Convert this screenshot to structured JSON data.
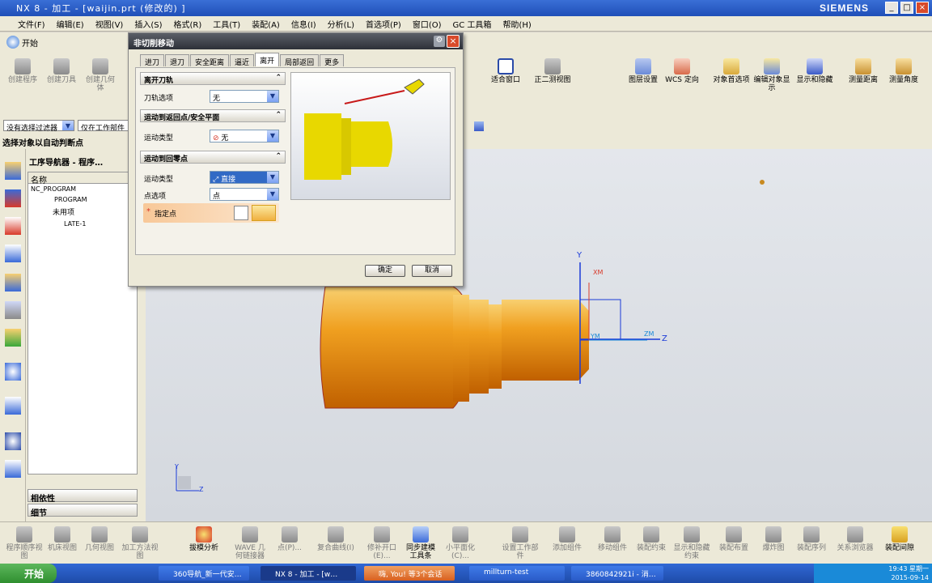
{
  "window": {
    "title": "NX 8 - 加工 - [waijin.prt  (修改的) ]",
    "brand": "SIEMENS"
  },
  "menu": [
    "文件(F)",
    "编辑(E)",
    "视图(V)",
    "插入(S)",
    "格式(R)",
    "工具(T)",
    "装配(A)",
    "信息(I)",
    "分析(L)",
    "首选项(P)",
    "窗口(O)",
    "GC 工具箱",
    "帮助(H)"
  ],
  "toolbar_top": {
    "start": "开始",
    "items": [
      "创建程序",
      "创建刀具",
      "创建几何体"
    ],
    "right_items": [
      "适合窗口",
      "正二测视图",
      "图层设置",
      "WCS 定向",
      "对象首选项",
      "编辑对象显示",
      "显示和隐藏",
      "测量距离",
      "测量角度"
    ]
  },
  "filters": {
    "selection_filter": "没有选择过滤器",
    "scope": "仅在工作部件"
  },
  "cue": "选择对象以自动判断点",
  "navigator": {
    "title": "工序导航器 - 程序…",
    "col_header": "名称",
    "tree": [
      {
        "label": "NC_PROGRAM"
      },
      {
        "label": "PROGRAM"
      },
      {
        "label": "未用项"
      },
      {
        "label": "LATE-1"
      }
    ],
    "panels": [
      "相依性",
      "细节"
    ]
  },
  "dialog": {
    "title": "非切削移动",
    "tabs": [
      "进刀",
      "退刀",
      "安全距离",
      "逼近",
      "离开",
      "局部返回",
      "更多"
    ],
    "active_tab": "离开",
    "sections": [
      {
        "header": "离开刀轨",
        "rows": [
          {
            "label": "刀轨选项",
            "value": "无"
          }
        ]
      },
      {
        "header": "运动到返回点/安全平面",
        "rows": [
          {
            "label": "运动类型",
            "value": "无"
          }
        ]
      },
      {
        "header": "运动到回零点",
        "rows": [
          {
            "label": "运动类型",
            "value": "直接"
          },
          {
            "label": "点选项",
            "value": "点"
          }
        ]
      }
    ],
    "specify_point": "指定点",
    "ok": "确定",
    "cancel": "取消"
  },
  "axes": {
    "y": "Y",
    "xm": "XM",
    "zm": "ZM",
    "z": "Z",
    "ym": "YM",
    "tri_y": "Y",
    "tri_z": "Z"
  },
  "bottom_toolbar": [
    "程序顺序视图",
    "机床视图",
    "几何视图",
    "加工方法视图",
    "拔模分析",
    "WAVE 几何链接器",
    "点(P)...",
    "复合曲线(I)",
    "修补开口(E)...",
    "同步建模工具条",
    "小平面化(C)...",
    "设置工作部件",
    "添加组件",
    "移动组件",
    "装配约束",
    "显示和隐藏约束",
    "装配布置",
    "爆炸图",
    "装配序列",
    "关系浏览器",
    "装配间隙"
  ],
  "taskbar": {
    "start": "开始",
    "tasks": [
      "360导航_新一代安…",
      "NX 8 - 加工 - [w…",
      "嗨, You! 等3个会话",
      "millturn-test",
      "3860842921i - 消…"
    ],
    "time": "19:43 星期一",
    "date": "2015-09-14"
  },
  "colors": {
    "part": "#f0a020",
    "dialog_bg": "#ece9d8",
    "title": "#2457c4"
  }
}
